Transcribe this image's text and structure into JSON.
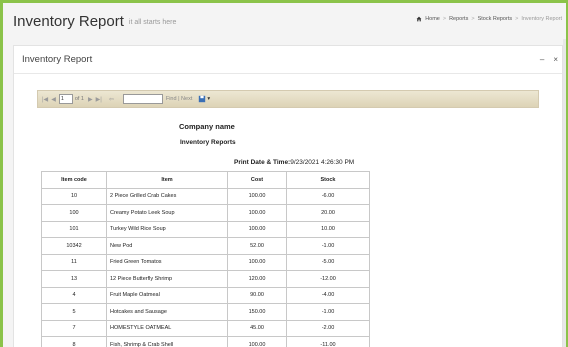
{
  "header": {
    "title": "Inventory Report",
    "subtitle": "it all starts here",
    "breadcrumb": [
      "Home",
      "Reports",
      "Stock Reports",
      "Inventory Report"
    ]
  },
  "panel": {
    "title": "Inventory Report",
    "minimize_label": "–",
    "close_label": "×"
  },
  "toolbar": {
    "page_value": "1",
    "of_text": "of 1",
    "find_label": "Find",
    "sep": "|",
    "next_label": "Next"
  },
  "report": {
    "company": "Company name",
    "title": "Inventory Reports",
    "print_label": "Print Date & Time:",
    "print_value": "9/23/2021 4:26:30 PM",
    "columns": [
      "Item code",
      "Item",
      "Cost",
      "Stock"
    ],
    "rows": [
      [
        "10",
        "2 Piece Grilled Crab Cakes",
        "100.00",
        "-6.00"
      ],
      [
        "100",
        "Creamy Potato Leek Soup",
        "100.00",
        "20.00"
      ],
      [
        "101",
        "Turkey Wild Rice Soup",
        "100.00",
        "10.00"
      ],
      [
        "10342",
        "New Pod",
        "52.00",
        "-1.00"
      ],
      [
        "11",
        "Fried Green Tomatos",
        "100.00",
        "-5.00"
      ],
      [
        "13",
        "12 Piece Butterfly Shrimp",
        "120.00",
        "-12.00"
      ],
      [
        "4",
        "Fruit Maple Oatmeal",
        "90.00",
        "-4.00"
      ],
      [
        "5",
        "Hotcakes and Sausage",
        "150.00",
        "-1.00"
      ],
      [
        "7",
        "HOMESTYLE OATMEAL",
        "45.00",
        "-2.00"
      ],
      [
        "8",
        "Fish, Shrimp & Crab Shell",
        "100.00",
        "-11.00"
      ]
    ]
  },
  "colors": {
    "frame_accent": "#8bc34a",
    "toolbar_bg": "#e6dfc6"
  }
}
